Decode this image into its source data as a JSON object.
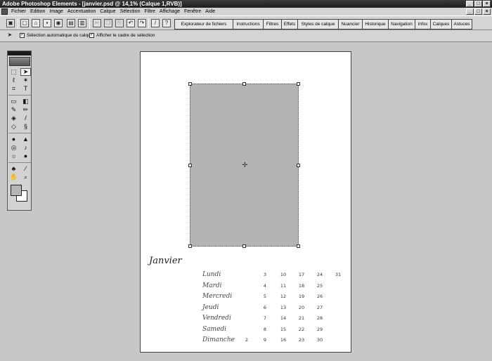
{
  "window": {
    "title": "Adobe Photoshop Elements - [janvier.psd @ 14,1% (Calque 1,RVB)]",
    "controls": [
      "_",
      "□",
      "×"
    ]
  },
  "menu": {
    "items": [
      "Fichier",
      "Edition",
      "Image",
      "Accentuation",
      "Calque",
      "Sélection",
      "Filtre",
      "Affichage",
      "Fenêtre",
      "Aide"
    ],
    "doc_controls": [
      "_",
      "□",
      "×"
    ]
  },
  "toolbar": {
    "icons": [
      "quick-fix-icon",
      "new-file-icon",
      "open-icon",
      "save-icon",
      "save-web-icon",
      "print-icon",
      "print-preview-icon",
      "step-back-icon",
      "step-forward-icon",
      "help-icon"
    ]
  },
  "palette_well": {
    "tabs": [
      "Explorateur de fichiers",
      "Instructions",
      "Filtres",
      "Effets",
      "Styles de calque",
      "Nuancier",
      "Historique",
      "Navigation",
      "Infos",
      "Calques",
      "Astuces"
    ]
  },
  "options": {
    "auto_select_label": "Sélection automatique du calque",
    "bounding_box_label": "Afficher le cadre de sélection",
    "auto_select_checked": "✓",
    "bounding_box_checked": "✓"
  },
  "toolbox": {
    "tools": [
      "marquee-tool",
      "move-tool",
      "lasso-tool",
      "magic-wand-tool",
      "crop-tool",
      "type-tool",
      "shape-tool",
      "gradient-tool",
      "brush-tool",
      "pencil-tool",
      "paint-bucket-tool",
      "eraser-tool",
      "smudge-tool",
      "clone-stamp-tool",
      "blur-tool",
      "sharpen-tool",
      "sponge-tool",
      "dodge-tool",
      "red-eye-tool",
      "burn-tool",
      "selection-brush-tool",
      "eyedropper-tool",
      "hand-tool",
      "zoom-tool"
    ],
    "foreground_color": "#b6b6b6",
    "background_color": "#ffffff"
  },
  "calendar": {
    "month": "Janvier",
    "days": [
      "Lundi",
      "Mardi",
      "Mercredi",
      "Jeudi",
      "Vendredi",
      "Samedi",
      "Dimanche"
    ],
    "weeks": [
      [
        "",
        "",
        "",
        "",
        "",
        "",
        "2"
      ],
      [
        "3",
        "4",
        "5",
        "6",
        "7",
        "8",
        "9"
      ],
      [
        "10",
        "11",
        "12",
        "13",
        "14",
        "15",
        "16"
      ],
      [
        "17",
        "18",
        "19",
        "20",
        "21",
        "22",
        "23"
      ],
      [
        "24",
        "25",
        "26",
        "27",
        "28",
        "29",
        "30"
      ],
      [
        "31",
        "",
        "",
        "",
        "",
        "",
        ""
      ]
    ]
  }
}
